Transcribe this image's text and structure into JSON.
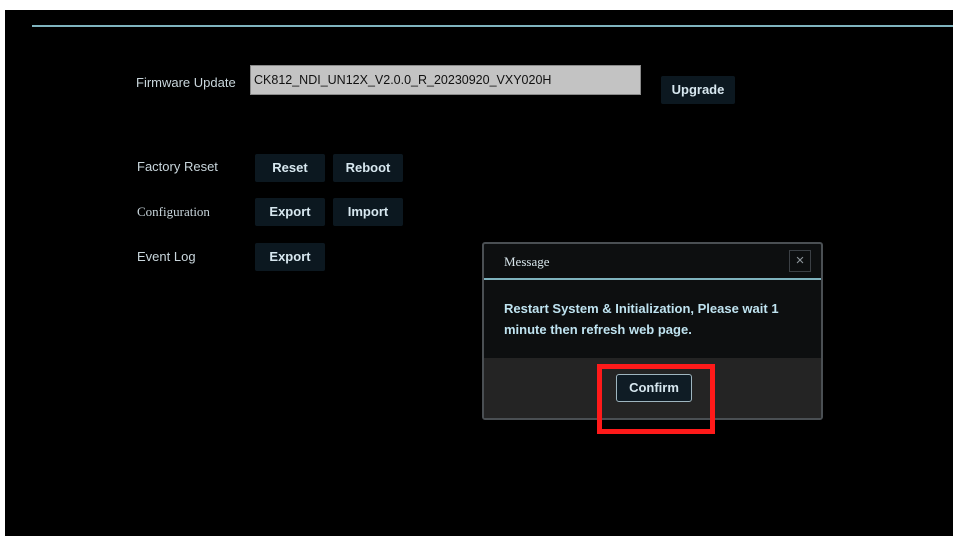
{
  "firmware_update": {
    "label": "Firmware Update",
    "file_value": "CK812_NDI_UN12X_V2.0.0_R_20230920_VXY020H",
    "upgrade_label": "Upgrade"
  },
  "factory_reset": {
    "label": "Factory Reset",
    "reset_label": "Reset",
    "reboot_label": "Reboot"
  },
  "configuration": {
    "label": "Configuration",
    "export_label": "Export",
    "import_label": "Import"
  },
  "event_log": {
    "label": "Event Log",
    "export_label": "Export"
  },
  "dialog": {
    "title": "Message",
    "close_icon": "×",
    "message": "Restart System & Initialization, Please wait 1 minute then refresh web page.",
    "confirm_label": "Confirm"
  },
  "colors": {
    "accent": "#7fb3be",
    "background": "#000000",
    "highlight": "#ff1a1a"
  }
}
